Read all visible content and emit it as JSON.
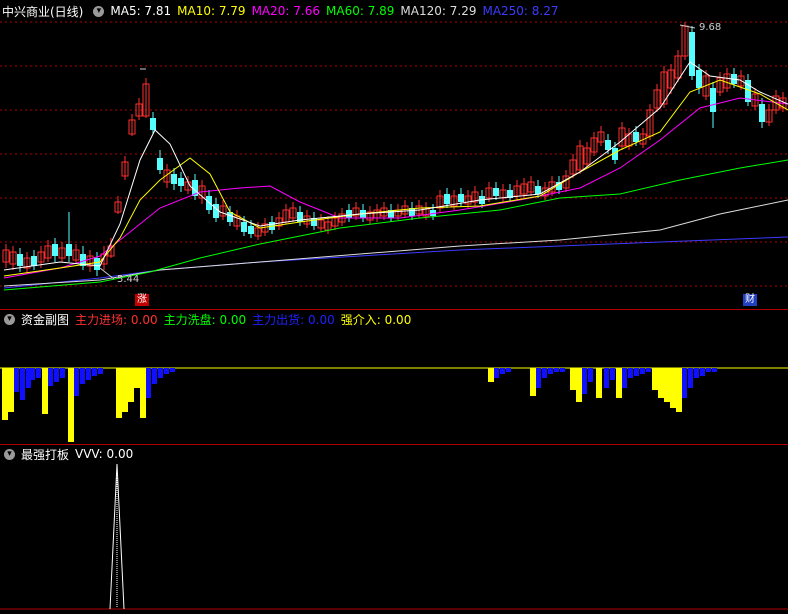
{
  "main_panel": {
    "title": "中兴商业(日线)",
    "ma_readouts": [
      {
        "label": "MA5: 7.81",
        "color": "#ffffff"
      },
      {
        "label": "MA10: 7.79",
        "color": "#ffff00"
      },
      {
        "label": "MA20: 7.66",
        "color": "#ff00ff"
      },
      {
        "label": "MA60: 7.89",
        "color": "#00ff00"
      },
      {
        "label": "MA120: 7.29",
        "color": "#dddddd"
      },
      {
        "label": "MA250: 8.27",
        "color": "#3b3bff"
      }
    ],
    "high_marker": "9.68",
    "low_marker": "5.44",
    "tag_zhang": "涨",
    "tag_cai": "财"
  },
  "fund_panel": {
    "title": "资金副图",
    "readouts": [
      {
        "label": "主力进场: 0.00",
        "color": "#ff3030"
      },
      {
        "label": "主力洗盘: 0.00",
        "color": "#00ff00"
      },
      {
        "label": "主力出货: 0.00",
        "color": "#2020ff"
      },
      {
        "label": "强介入: 0.00",
        "color": "#ffff00"
      }
    ]
  },
  "signal_panel": {
    "title": "最强打板",
    "readout": "VVV: 0.00"
  },
  "colors": {
    "up": "#ff3030",
    "down": "#54ffff",
    "grid": "#b00000",
    "ma5": "#ffffff",
    "ma10": "#ffff00",
    "ma20": "#ff00ff",
    "ma60": "#00ff00",
    "ma120": "#dddddd",
    "ma250": "#3b3bff"
  }
}
